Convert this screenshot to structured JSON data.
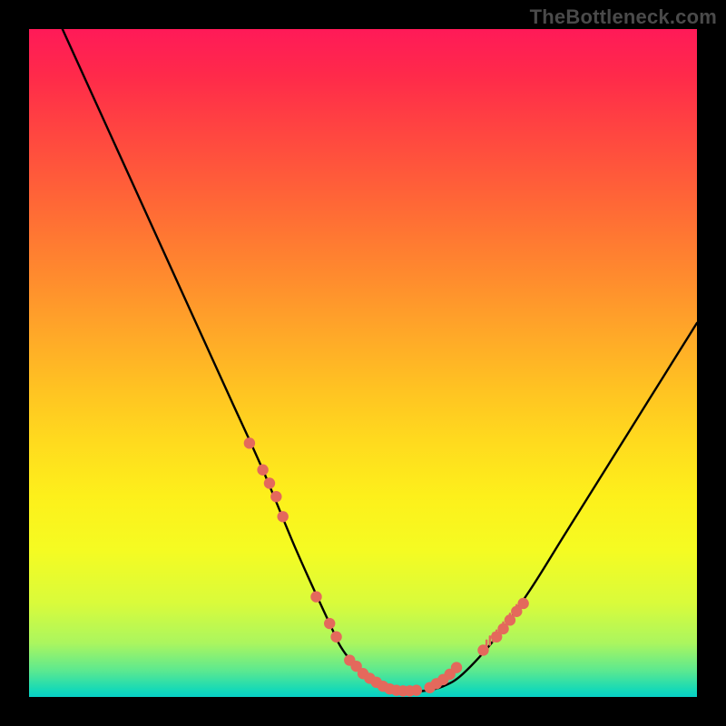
{
  "watermark": "TheBottleneck.com",
  "chart_data": {
    "type": "line",
    "title": "",
    "xlabel": "",
    "ylabel": "",
    "xlim": [
      0,
      100
    ],
    "ylim": [
      0,
      100
    ],
    "series": [
      {
        "name": "curve",
        "x": [
          5,
          10,
          15,
          20,
          25,
          30,
          35,
          40,
          45,
          47,
          50,
          53,
          56,
          59,
          62,
          65,
          70,
          75,
          80,
          85,
          90,
          95,
          100
        ],
        "values": [
          100,
          89,
          78,
          67,
          56,
          45,
          34,
          22,
          11,
          7,
          3.5,
          1.6,
          0.9,
          0.9,
          1.6,
          3.5,
          9,
          16,
          24,
          32,
          40,
          48,
          56
        ]
      }
    ],
    "markers": {
      "name": "highlight-dots",
      "color": "#e4695c",
      "x": [
        33,
        35,
        36,
        37,
        38,
        43,
        45,
        46,
        48,
        49,
        50,
        51,
        52,
        53,
        54,
        55,
        56,
        57,
        58,
        60,
        61,
        62,
        63,
        64,
        68,
        70,
        71,
        72,
        73,
        74
      ],
      "values": [
        38,
        34,
        32,
        30,
        27,
        15,
        11,
        9,
        5.5,
        4.6,
        3.5,
        2.8,
        2.2,
        1.6,
        1.2,
        1.0,
        0.9,
        0.9,
        1.0,
        1.4,
        2.0,
        2.6,
        3.4,
        4.4,
        7.0,
        9.0,
        10.2,
        11.5,
        12.8,
        14.0
      ]
    },
    "ticks": {
      "name": "small-ticks",
      "color": "#e4695c",
      "x": [
        68.5,
        69,
        69.5,
        70,
        70.5,
        71,
        71.5,
        72,
        72.5,
        73,
        73.5
      ],
      "values": [
        7.5,
        8.1,
        8.6,
        9.0,
        9.6,
        10.2,
        10.8,
        11.5,
        12.1,
        12.8,
        13.4
      ]
    }
  }
}
